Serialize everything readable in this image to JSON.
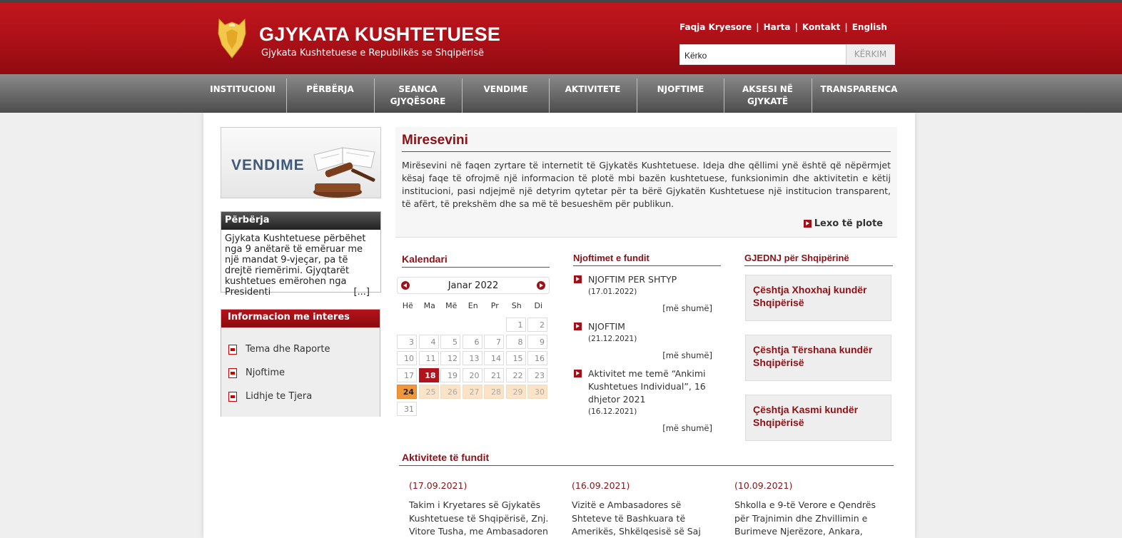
{
  "header": {
    "title": "GJYKATA KUSHTETUESE",
    "subtitle": "Gjykata Kushtetuese e Republikës se Shqipërisë",
    "links": [
      "Faqja Kryesore",
      "Harta",
      "Kontakt",
      "English"
    ],
    "search_value": "Kërko",
    "search_button": "KËRKIM"
  },
  "nav": [
    "INSTITUCIONI",
    "PËRBËRJA",
    "SEANCA\nGJYQËSORE",
    "VENDIME",
    "AKTIVITETE",
    "NJOFTIME",
    "AKSESI NË\nGJYKATË",
    "TRANSPARENCA"
  ],
  "sidebar": {
    "banner_label": "VENDIME",
    "perberja_title": "Përbërja",
    "perberja_text": "Gjykata Kushtetuese përbëhet nga 9 anëtarë të emëruar me një mandat 9-vjeçar, pa të drejtë riemërimi. Gjyqtarët kushtetues emërohen nga Presidenti",
    "perberja_more": "[...]",
    "info_title": "Informacion me interes",
    "info_items": [
      "Tema dhe Raporte",
      "Njoftime",
      "Lidhje te Tjera"
    ]
  },
  "welcome": {
    "title": "Miresevini",
    "text": "Mirësevini në faqen zyrtare të internetit të Gjykatës Kushtetuese. Ideja dhe qëllimi ynë është që nëpërmjet kësaj faqe të ofrojmë një informacion të plotë mbi bazën kushtetuese, funksionimin dhe aktivitetin e këtij institucioni, pasi ndjejmë një detyrim qytetar për ta bërë Gjykatën Kushtetuese një institucion transparent, të afërt, të prekshëm dhe sa më të besueshëm për publikun.",
    "read_more": "Lexo të plote"
  },
  "calendar": {
    "title": "Kalendari",
    "month": "Janar 2022",
    "days_of_week": [
      "Hë",
      "Ma",
      "Më",
      "En",
      "Pr",
      "Sh",
      "Di"
    ],
    "offset": 5,
    "days": 31,
    "today": 18,
    "selected": 24,
    "highlight_range": [
      25,
      30
    ]
  },
  "news": {
    "title": "Njoftimet e fundit",
    "more_label": "[më shumë]",
    "items": [
      {
        "title": "NJOFTIM PER SHTYP",
        "date": "(17.01.2022)"
      },
      {
        "title": "NJOFTIM",
        "date": "(21.12.2021)"
      },
      {
        "title": "Aktivitet me temë “Ankimi Kushtetues Individual”, 16 dhjetor 2021",
        "date": "(16.12.2021)"
      }
    ]
  },
  "gjednj": {
    "title": "GJEDNJ për Shqipërinë",
    "cases": [
      "Çështja Xhoxhaj kundër Shqipërisë",
      "Çështja Tërshana kundër Shqipërisë",
      "Çështja Kasmi kundër Shqipërisë"
    ]
  },
  "activities": {
    "title": "Aktivitete të fundit",
    "items": [
      {
        "date": "(17.09.2021)",
        "text": "Takim i Kryetares së Gjykatës Kushtetuese të Shqipërisë, Znj. Vitore Tusha, me Ambasadoren"
      },
      {
        "date": "(16.09.2021)",
        "text": "Vizitë e Ambasadores së Shteteve të Bashkuara të Amerikës, Shkëlqesisë së Saj"
      },
      {
        "date": "(10.09.2021)",
        "text": "Shkolla e 9-të Verore e Qendrës për Trajnimin dhe Zhvillimin e Burimeve Njerëzore, Ankara,"
      }
    ]
  }
}
